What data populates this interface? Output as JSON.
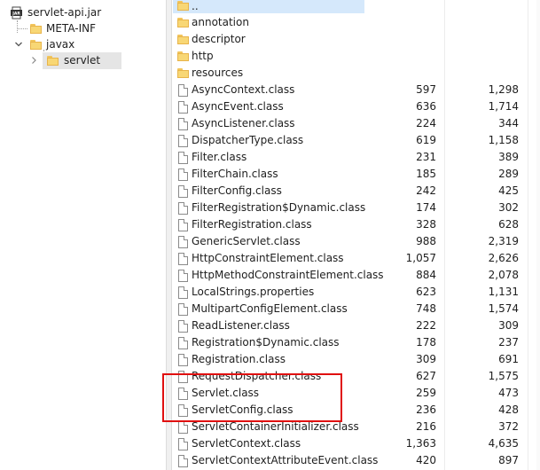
{
  "tree": {
    "root": {
      "label": "servlet-api.jar",
      "icon": "jar-icon"
    },
    "items": [
      {
        "label": "META-INF",
        "icon": "folder-icon"
      },
      {
        "label": "javax",
        "icon": "folder-icon",
        "expanded": true
      },
      {
        "label": "servlet",
        "icon": "folder-icon",
        "selected": true
      }
    ]
  },
  "list": {
    "up_label": "..",
    "folders": [
      "annotation",
      "descriptor",
      "http",
      "resources"
    ],
    "files": [
      {
        "name": "AsyncContext.class",
        "packed": "597",
        "size": "1,298"
      },
      {
        "name": "AsyncEvent.class",
        "packed": "636",
        "size": "1,714"
      },
      {
        "name": "AsyncListener.class",
        "packed": "224",
        "size": "344"
      },
      {
        "name": "DispatcherType.class",
        "packed": "619",
        "size": "1,158"
      },
      {
        "name": "Filter.class",
        "packed": "231",
        "size": "389"
      },
      {
        "name": "FilterChain.class",
        "packed": "185",
        "size": "289"
      },
      {
        "name": "FilterConfig.class",
        "packed": "242",
        "size": "425"
      },
      {
        "name": "FilterRegistration$Dynamic.class",
        "packed": "174",
        "size": "302"
      },
      {
        "name": "FilterRegistration.class",
        "packed": "328",
        "size": "628"
      },
      {
        "name": "GenericServlet.class",
        "packed": "988",
        "size": "2,319"
      },
      {
        "name": "HttpConstraintElement.class",
        "packed": "1,057",
        "size": "2,626"
      },
      {
        "name": "HttpMethodConstraintElement.class",
        "packed": "884",
        "size": "2,078"
      },
      {
        "name": "LocalStrings.properties",
        "packed": "623",
        "size": "1,131"
      },
      {
        "name": "MultipartConfigElement.class",
        "packed": "748",
        "size": "1,574"
      },
      {
        "name": "ReadListener.class",
        "packed": "222",
        "size": "309"
      },
      {
        "name": "Registration$Dynamic.class",
        "packed": "178",
        "size": "237"
      },
      {
        "name": "Registration.class",
        "packed": "309",
        "size": "691"
      },
      {
        "name": "RequestDispatcher.class",
        "packed": "627",
        "size": "1,575"
      },
      {
        "name": "Servlet.class",
        "packed": "259",
        "size": "473"
      },
      {
        "name": "ServletConfig.class",
        "packed": "236",
        "size": "428"
      },
      {
        "name": "ServletContainerInitializer.class",
        "packed": "216",
        "size": "372"
      },
      {
        "name": "ServletContext.class",
        "packed": "1,363",
        "size": "4,635"
      },
      {
        "name": "ServletContextAttributeEvent.class",
        "packed": "420",
        "size": "897"
      }
    ]
  },
  "colors": {
    "highlight_box": "#e01010",
    "selection": "#d5e8fb",
    "folder": "#f8d775"
  }
}
